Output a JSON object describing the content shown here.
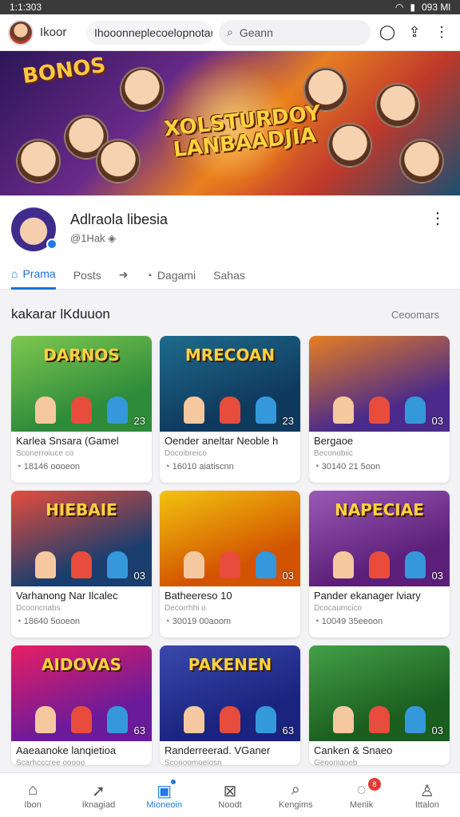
{
  "statusbar": {
    "time": "1:1:303",
    "right": "093 Ml"
  },
  "topbar": {
    "brand": "Ikoor",
    "url": "Ihooonneplecoelopnotaniorg",
    "search_placeholder": "Geann",
    "search_icon": "search-icon",
    "chat_icon": "chat-icon",
    "share_icon": "share-icon",
    "more_icon": "more-icon"
  },
  "banner": {
    "title_line1": "XOLSTURDOY",
    "title_line2": "LANBAADJIA",
    "top_text": "BONOS"
  },
  "profile": {
    "name": "Adlraola libesia",
    "handle": "@1Hak"
  },
  "tabs": [
    {
      "label": "Prama",
      "icon": "home-icon",
      "active": true
    },
    {
      "label": "Posts",
      "icon": "",
      "active": false
    },
    {
      "label": "",
      "icon": "share-arrow-icon",
      "active": false
    },
    {
      "label": "Dagami",
      "icon": "clock-icon",
      "active": false
    },
    {
      "label": "Sahas",
      "icon": "",
      "active": false
    }
  ],
  "section": {
    "title": "kakarar lKduuon",
    "link": "Ceoomars"
  },
  "cards": [
    {
      "thumb_text": "DARNOS",
      "count": "23",
      "title": "Karlea Snsara (Gamel",
      "sub": "Sconerroiuce co",
      "meta": "18146 oooeon",
      "bg": "#2e8b3a",
      "bg2": "#7ec850"
    },
    {
      "thumb_text": "MRECOAN",
      "count": "23",
      "title": "Oender aneltar Neoble h",
      "sub": "Docoibreico",
      "meta": "16010 aiatiscnn",
      "bg": "#0f3a5e",
      "bg2": "#1e6b8c"
    },
    {
      "thumb_text": "",
      "count": "03",
      "title": "Bergaoe",
      "sub": "Beconobiic",
      "meta": "30140 21 5oon",
      "bg": "#4a2a8a",
      "bg2": "#e67e22"
    },
    {
      "thumb_text": "HIEBAIE",
      "count": "03",
      "title": "Varhanong Nar Ilcalec",
      "sub": "Dcooncnabs",
      "meta": "18640 5ooeon",
      "bg": "#1a3e6e",
      "bg2": "#e74c3c"
    },
    {
      "thumb_text": "",
      "count": "03",
      "title": "Batheereso 10",
      "sub": "Decorrhhi o",
      "meta": "30019 00aoom",
      "bg": "#d35400",
      "bg2": "#f1c40f"
    },
    {
      "thumb_text": "NAPECIAE",
      "count": "03",
      "title": "Pander ekanager lviary",
      "sub": "Dcocaumcico",
      "meta": "10049 35eeoon",
      "bg": "#5b1f7a",
      "bg2": "#9b59b6"
    },
    {
      "thumb_text": "AIDOVAS",
      "count": "63",
      "title": "Aaeaanoke lanqietioa",
      "sub": "Scarhcccree ooooo",
      "meta": "",
      "bg": "#6a1b9a",
      "bg2": "#e91e63"
    },
    {
      "thumb_text": "PAKENEN",
      "count": "63",
      "title": "Randerreerad. VGaner",
      "sub": "Scorioomoeiosn",
      "meta": "",
      "bg": "#1a237e",
      "bg2": "#3949ab"
    },
    {
      "thumb_text": "",
      "count": "03",
      "title": "Canken & Snaeo",
      "sub": "Geooniaoeb",
      "meta": "",
      "bg": "#1b5e20",
      "bg2": "#43a047"
    }
  ],
  "nav": [
    {
      "label": "Ibon",
      "icon": "home-icon",
      "active": false,
      "badge": ""
    },
    {
      "label": "Iknagiad",
      "icon": "paper-plane-icon",
      "active": false,
      "badge": ""
    },
    {
      "label": "Mioneoin",
      "icon": "people-icon",
      "active": true,
      "badge": "dot"
    },
    {
      "label": "Noodt",
      "icon": "close-box-icon",
      "active": false,
      "badge": ""
    },
    {
      "label": "Kengims",
      "icon": "search-icon",
      "active": false,
      "badge": ""
    },
    {
      "label": "Menik",
      "icon": "chat-icon",
      "active": false,
      "badge": "8"
    },
    {
      "label": "Ittalon",
      "icon": "user-icon",
      "active": false,
      "badge": ""
    }
  ]
}
